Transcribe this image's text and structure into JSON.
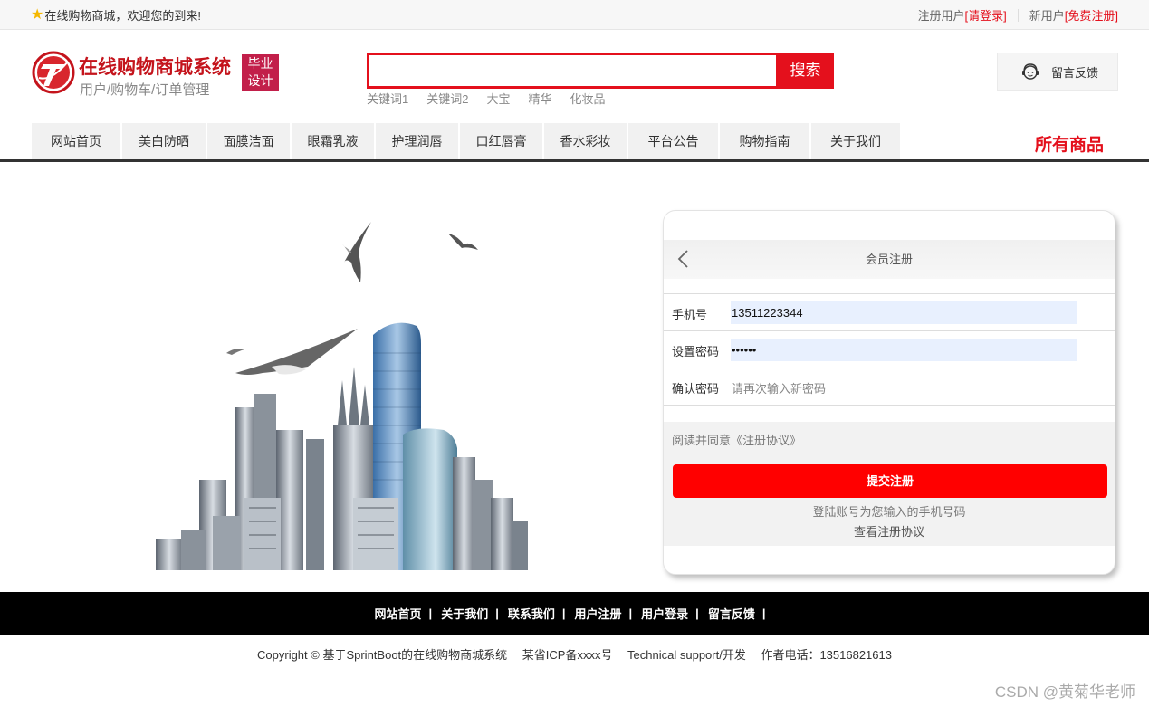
{
  "topbar": {
    "welcome": "在线购物商城，欢迎您的到来!",
    "register_prefix": "注册用户",
    "login_link": "[请登录]",
    "new_user_prefix": "新用户",
    "free_register_link": "[免费注册]"
  },
  "header": {
    "brand_title": "在线购物商城系统",
    "brand_subtitle": "用户/购物车/订单管理",
    "badge_line1": "毕业",
    "badge_line2": "设计",
    "search_value": "",
    "search_button": "搜索",
    "keywords": [
      "关键词1",
      "关键词2",
      "大宝",
      "精华",
      "化妆品"
    ],
    "feedback_button": "留言反馈"
  },
  "nav": {
    "items": [
      "网站首页",
      "美白防晒",
      "面膜洁面",
      "眼霜乳液",
      "护理润唇",
      "口红唇膏",
      "香水彩妆",
      "平台公告",
      "购物指南",
      "关于我们"
    ],
    "all_goods": "所有商品"
  },
  "register": {
    "title": "会员注册",
    "phone_label": "手机号",
    "phone_value": "13511223344",
    "password_label": "设置密码",
    "password_value": "••••••",
    "confirm_label": "确认密码",
    "confirm_placeholder": "请再次输入新密码",
    "agree_text": "阅读并同意《注册协议》",
    "submit_button": "提交注册",
    "tip_account": "登陆账号为您输入的手机号码",
    "tip_view_agreement": "查看注册协议"
  },
  "footer": {
    "links": [
      "网站首页",
      "关于我们",
      "联系我们",
      "用户注册",
      "用户登录",
      "留言反馈"
    ],
    "separator": "|",
    "copyright": "Copyright © 基于SprintBoot的在线购物商城系统　 某省ICP备xxxx号　 Technical support/开发　 作者电话：13516821613"
  },
  "watermark": "CSDN @黄菊华老师",
  "colors": {
    "brand_red": "#e4101c",
    "badge": "#c21f4a",
    "submit": "#ff0000",
    "footer_bg": "#000000"
  }
}
